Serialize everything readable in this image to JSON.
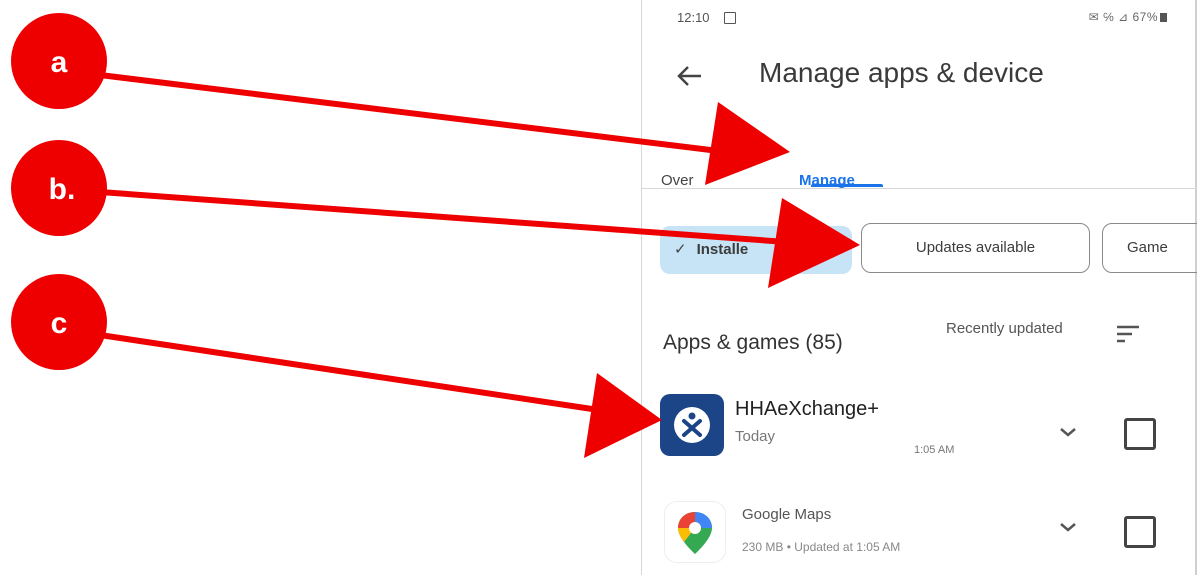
{
  "status_bar": {
    "time": "12:10",
    "right": "✉ ℅ ⊿ 67%"
  },
  "header": {
    "title": "Manage apps & device"
  },
  "tabs": [
    {
      "label": "Over"
    },
    {
      "label": "Manage"
    }
  ],
  "filters": {
    "installed_check": "✓",
    "installed_label": "Installe",
    "updates_label": "Updates available",
    "games_label": "Game"
  },
  "section": {
    "title": "Apps & games (85)",
    "sort_label": "Recently updated"
  },
  "apps": [
    {
      "name": "HHAeXchange+",
      "subtitle": "Today",
      "time": "1:05 AM"
    },
    {
      "name": "Google Maps",
      "subtitle": "230 MB • Updated at 1:05 AM"
    }
  ],
  "annotations": {
    "labels": [
      "a",
      "b.",
      "c"
    ],
    "color": "#ee0000"
  },
  "colors": {
    "accent": "#1a73e8",
    "chip_selected": "#c7e3f6",
    "hha_icon": "#1c4587"
  },
  "icons": [
    "back-arrow-icon",
    "sort-icon",
    "chevron-down-icon",
    "checkbox-icon"
  ]
}
